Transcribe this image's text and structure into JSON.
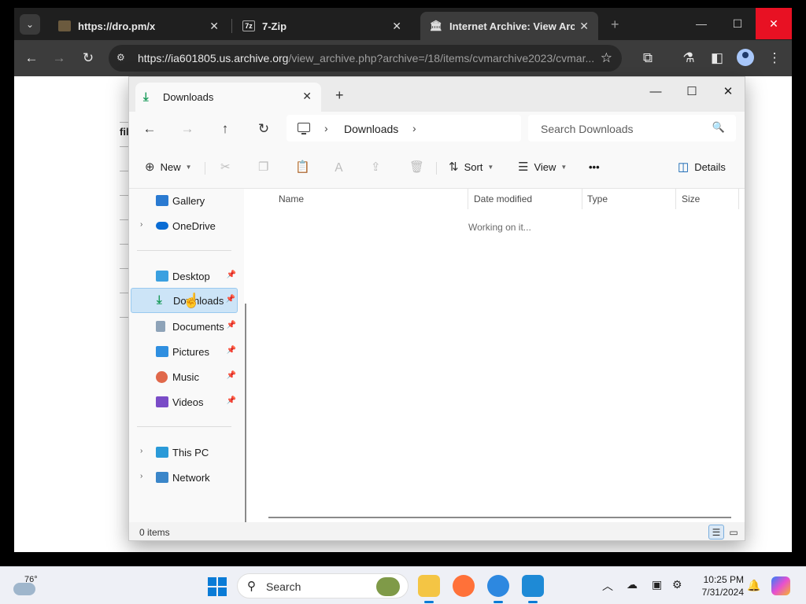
{
  "browser": {
    "tabs": [
      {
        "title": "https://dro.pm/x",
        "close": "✕"
      },
      {
        "title": "7-Zip",
        "close": "✕"
      },
      {
        "title": "Internet Archive: View Archive",
        "close": "✕"
      }
    ],
    "new_tab": "+",
    "url_host": "https://ia601805.us.archive.org",
    "url_path": "/view_archive.php?archive=/18/items/cvmarchive2023/cvmar...",
    "page_fragment": "fil"
  },
  "explorer": {
    "tab_title": "Downloads",
    "breadcrumb": "Downloads",
    "search_placeholder": "Search Downloads",
    "commands": {
      "new": "New",
      "sort": "Sort",
      "view": "View",
      "more": "•••",
      "details": "Details"
    },
    "nav": {
      "gallery": "Gallery",
      "onedrive": "OneDrive",
      "desktop": "Desktop",
      "downloads": "Downloads",
      "documents": "Documents",
      "pictures": "Pictures",
      "music": "Music",
      "videos": "Videos",
      "this_pc": "This PC",
      "network": "Network"
    },
    "columns": {
      "name": "Name",
      "date_modified": "Date modified",
      "type": "Type",
      "size": "Size"
    },
    "working_text": "Working on it...",
    "status_count": "0 items"
  },
  "taskbar": {
    "temperature": "76°",
    "search_label": "Search",
    "time": "10:25 PM",
    "date": "7/31/2024"
  }
}
